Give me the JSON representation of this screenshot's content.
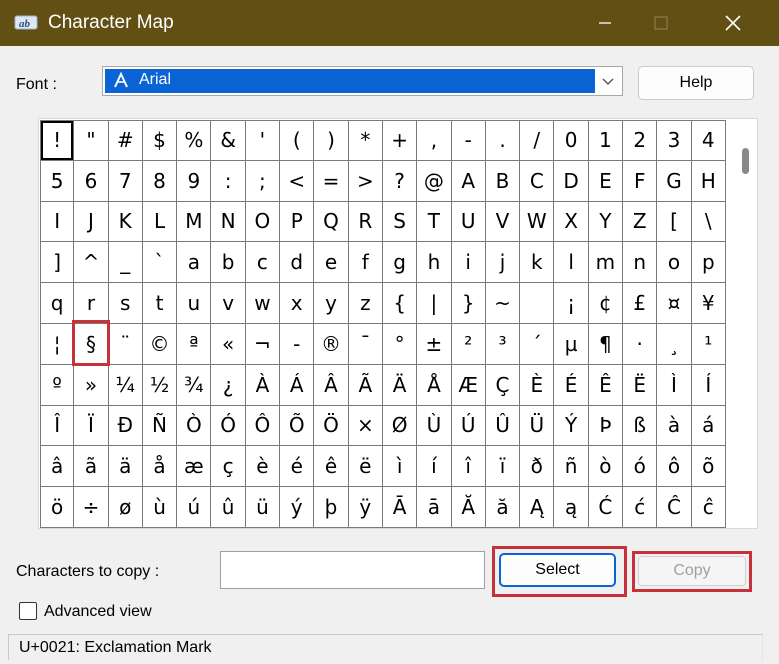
{
  "window": {
    "title": "Character Map",
    "icon": "charmap-app-icon",
    "controls": [
      "minimize-icon",
      "maximize-icon",
      "close-icon"
    ]
  },
  "font": {
    "label": "Font :",
    "selected": "Arial",
    "help_label": "Help"
  },
  "grid": {
    "columns": 20,
    "selected_index": 0,
    "characters": [
      "!",
      "\"",
      "#",
      "$",
      "%",
      "&",
      "'",
      "(",
      ")",
      "*",
      "+",
      ",",
      "-",
      ".",
      "/",
      "0",
      "1",
      "2",
      "3",
      "4",
      "5",
      "6",
      "7",
      "8",
      "9",
      ":",
      ";",
      "<",
      "=",
      ">",
      "?",
      "@",
      "A",
      "B",
      "C",
      "D",
      "E",
      "F",
      "G",
      "H",
      "I",
      "J",
      "K",
      "L",
      "M",
      "N",
      "O",
      "P",
      "Q",
      "R",
      "S",
      "T",
      "U",
      "V",
      "W",
      "X",
      "Y",
      "Z",
      "[",
      "\\",
      "]",
      "^",
      "_",
      "`",
      "a",
      "b",
      "c",
      "d",
      "e",
      "f",
      "g",
      "h",
      "i",
      "j",
      "k",
      "l",
      "m",
      "n",
      "o",
      "p",
      "q",
      "r",
      "s",
      "t",
      "u",
      "v",
      "w",
      "x",
      "y",
      "z",
      "{",
      "|",
      "}",
      "~",
      " ",
      "¡",
      "¢",
      "£",
      "¤",
      "¥",
      "¦",
      "§",
      "¨",
      "©",
      "ª",
      "«",
      "¬",
      "-",
      "®",
      "¯",
      "°",
      "±",
      "²",
      "³",
      "´",
      "µ",
      "¶",
      "·",
      "¸",
      "¹",
      "º",
      "»",
      "¼",
      "½",
      "¾",
      "¿",
      "À",
      "Á",
      "Â",
      "Ã",
      "Ä",
      "Å",
      "Æ",
      "Ç",
      "È",
      "É",
      "Ê",
      "Ë",
      "Ì",
      "Í",
      "Î",
      "Ï",
      "Ð",
      "Ñ",
      "Ò",
      "Ó",
      "Ô",
      "Õ",
      "Ö",
      "×",
      "Ø",
      "Ù",
      "Ú",
      "Û",
      "Ü",
      "Ý",
      "Þ",
      "ß",
      "à",
      "á",
      "â",
      "ã",
      "ä",
      "å",
      "æ",
      "ç",
      "è",
      "é",
      "ê",
      "ë",
      "ì",
      "í",
      "î",
      "ï",
      "ð",
      "ñ",
      "ò",
      "ó",
      "ô",
      "õ",
      "ö",
      "÷",
      "ø",
      "ù",
      "ú",
      "û",
      "ü",
      "ý",
      "þ",
      "ÿ",
      "Ā",
      "ā",
      "Ă",
      "ă",
      "Ą",
      "ą",
      "Ć",
      "ć",
      "Ĉ",
      "ĉ"
    ]
  },
  "copy_section": {
    "label": "Characters to copy :",
    "value": "",
    "select_label": "Select",
    "copy_label": "Copy"
  },
  "advanced_view": {
    "label": "Advanced view",
    "checked": false
  },
  "status": {
    "text": "U+0021: Exclamation Mark"
  },
  "annotations": {
    "color": "#c5323a",
    "highlighted": [
      "§",
      "Select",
      "Copy"
    ]
  },
  "colors": {
    "titlebar": "#614f14",
    "selection": "#0a64d6"
  }
}
